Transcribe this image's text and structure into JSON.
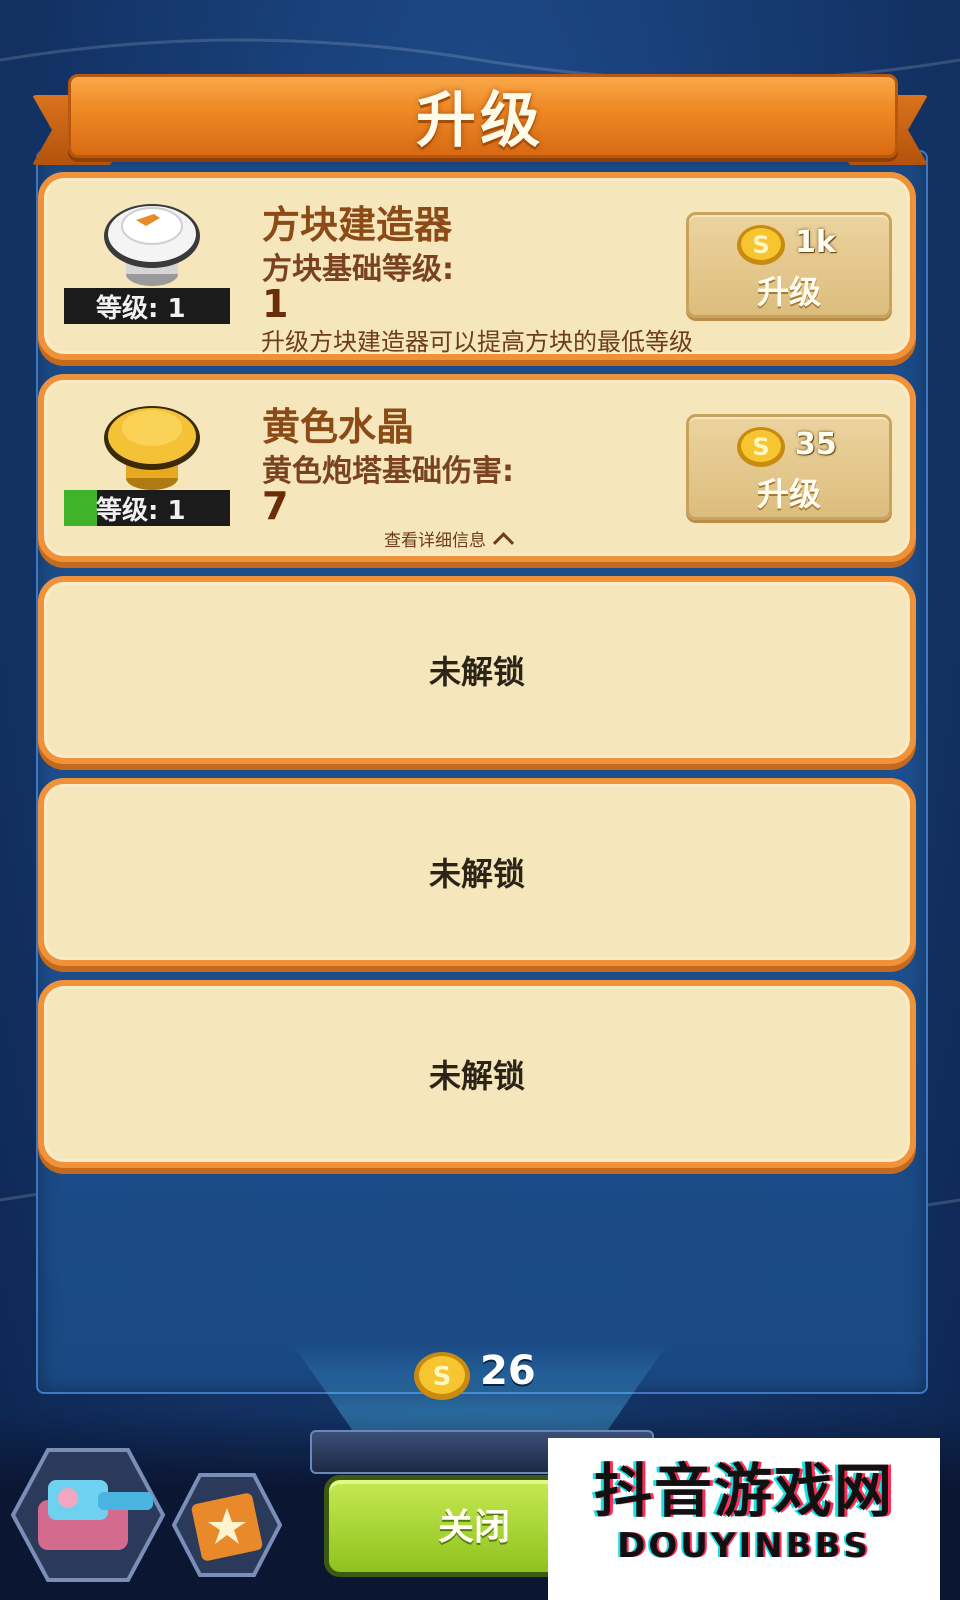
{
  "header": {
    "title": "升级"
  },
  "upgrades": [
    {
      "name": "方块建造器",
      "stat_label": "方块基础等级:",
      "stat_value": "1",
      "level_label": "等级: 1",
      "level_progress": 0,
      "description": "升级方块建造器可以提高方块的最低等级",
      "price": "1k",
      "button_label": "升级",
      "icon": "white-cap-icon"
    },
    {
      "name": "黄色水晶",
      "stat_label": "黄色炮塔基础伤害:",
      "stat_value": "7",
      "level_label": "等级: 1",
      "level_progress": 0.2,
      "details_label": "查看详细信息",
      "price": "35",
      "button_label": "升级",
      "icon": "yellow-cap-icon"
    }
  ],
  "locked_slots": [
    "未解锁",
    "未解锁",
    "未解锁"
  ],
  "footer": {
    "coins": "26",
    "close_label": "关闭"
  },
  "watermark": {
    "line1": "抖音游戏网",
    "line2": "DOUYINBBS"
  },
  "colors": {
    "ribbon": "#f08a26",
    "card_bg": "#f5e6bc",
    "card_border": "#f0923a",
    "close_btn": "#8fc21e"
  }
}
